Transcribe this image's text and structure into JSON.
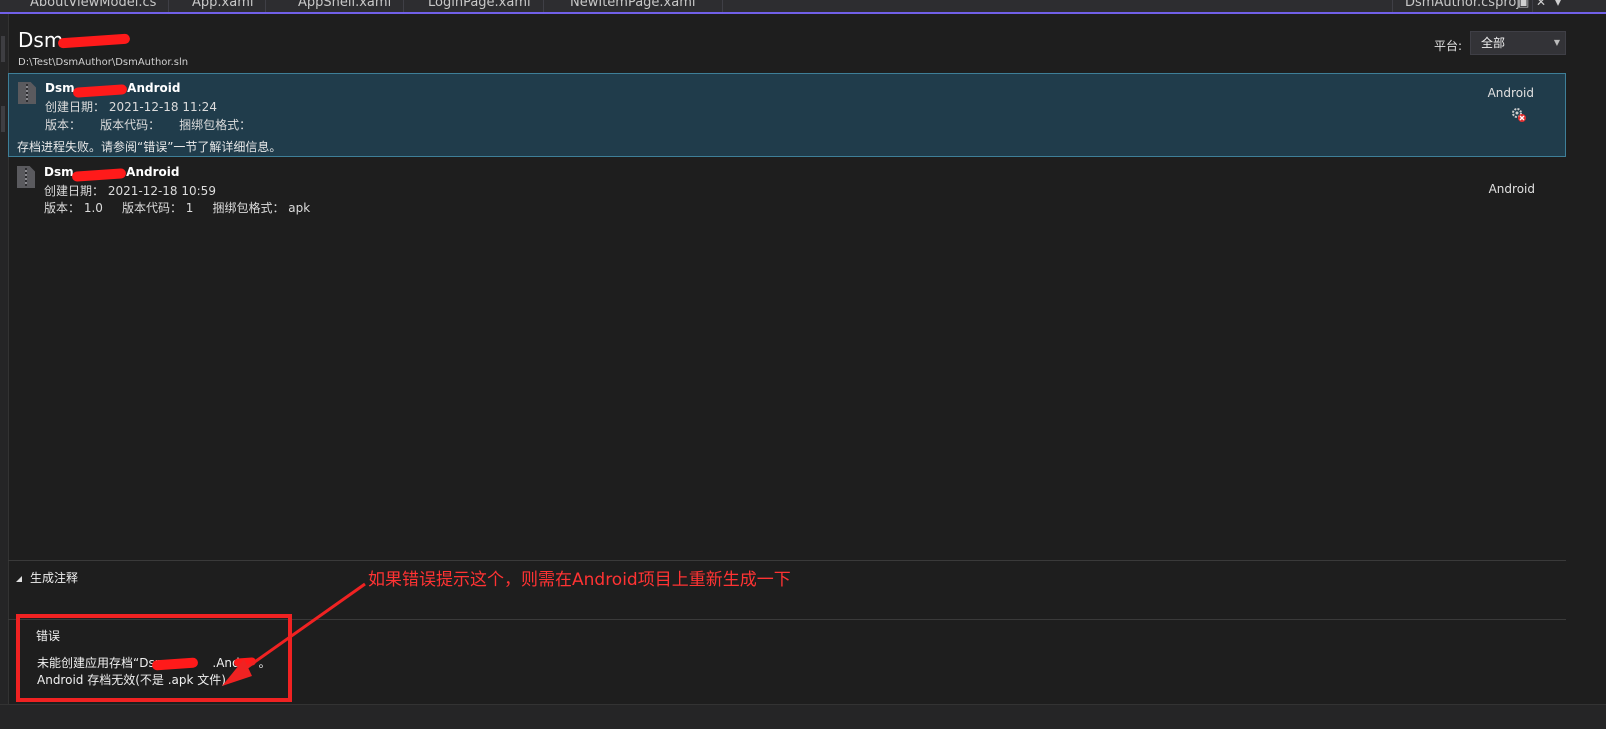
{
  "tabs": [
    "AboutViewModel.cs",
    "App.xaml",
    "AppShell.xaml",
    "LoginPage.xaml",
    "NewItemPage.xaml"
  ],
  "project_tab": "DsmAuthor.csproj",
  "tab_controls": {
    "pin": "▣",
    "close": "✕",
    "menu": "▾"
  },
  "header": {
    "title": "Dsm",
    "path": "D:\\Test\\DsmAuthor\\DsmAuthor.sln"
  },
  "platform": {
    "label": "平台:",
    "selected": "全部"
  },
  "archives": [
    {
      "name_start": "Dsm",
      "name_end": ".Android",
      "created": "创建日期： 2021-12-18 11:24",
      "version_line": "版本：     版本代码：     捆绑包格式：",
      "message": "存档进程失败。请参阅“错误”一节了解详细信息。",
      "platform": "Android",
      "status_icon": "build-error-gear-icon"
    },
    {
      "name_start": "Dsm",
      "name_end": ".Android",
      "created": "创建日期： 2021-12-18 10:59",
      "version_line": "版本： 1.0     版本代码： 1     捆绑包格式： apk",
      "platform": "Android"
    }
  ],
  "sections": {
    "build_notes": "生成注释",
    "errors": "错误"
  },
  "errors": {
    "line1": "未能创建应用存档“Dsm",
    "line1_end": ".Andr",
    "line1_tail": "。",
    "line2": "Android 存档无效(不是 .apk 文件)"
  },
  "annotation": "如果错误提示这个，则需在Android项目上重新生成一下",
  "colors": {
    "accent": "#7160e8",
    "selection": "#203c4b",
    "annotation": "#f02222"
  }
}
